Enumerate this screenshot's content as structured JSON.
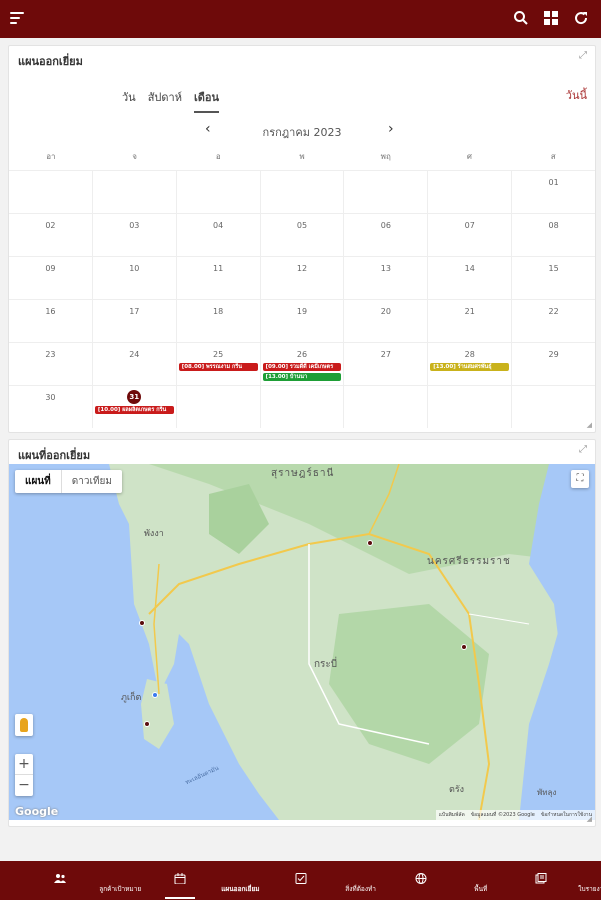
{
  "app": {
    "colors": {
      "primary": "#6e0a0a",
      "event_red": "#c91b1b",
      "event_green": "#1e9e36",
      "event_yellow": "#c9b21b"
    }
  },
  "calendar": {
    "title": "แผนออกเยี่ยม",
    "views": [
      "วัน",
      "สัปดาห์",
      "เดือน"
    ],
    "active_view": "เดือน",
    "today_label": "วันนี้",
    "month_label": "กรกฎาคม 2023",
    "weekdays": [
      "อา",
      "จ",
      "อ",
      "พ",
      "พฤ",
      "ศ",
      "ส"
    ],
    "weeks": [
      [
        "",
        "",
        "",
        "",
        "",
        "",
        "01"
      ],
      [
        "02",
        "03",
        "04",
        "05",
        "06",
        "07",
        "08"
      ],
      [
        "09",
        "10",
        "11",
        "12",
        "13",
        "14",
        "15"
      ],
      [
        "16",
        "17",
        "18",
        "19",
        "20",
        "21",
        "22"
      ],
      [
        "23",
        "24",
        "25",
        "26",
        "27",
        "28",
        "29"
      ],
      [
        "30",
        "31",
        "",
        "",
        "",
        "",
        ""
      ]
    ],
    "today_date": "31",
    "events": [
      {
        "text": "[08.00] พรรณงาม กรีน",
        "color": "red"
      },
      {
        "text": "[09.00] รวมดีดี เคมีเกษตร",
        "color": "red"
      },
      {
        "text": "[13.00] บ้านนา",
        "color": "green"
      },
      {
        "text": "[13.00] ร้านสมศรพันธุ์",
        "color": "yellow"
      },
      {
        "text": "[10.00] ผลผลิตเกษตร กรีน",
        "color": "red"
      }
    ]
  },
  "map_card": {
    "title": "แผนที่ออกเยี่ยม",
    "map_type_options": [
      "แผนที่",
      "ดาวเทียม"
    ],
    "selected_map_type": "แผนที่",
    "labels": {
      "surat": "สุราษฎร์ธานี",
      "nakhon": "นครศรีธรรมราช",
      "krabi": "กระบี่",
      "phangnga": "พังงา",
      "phuket": "ภูเก็ต",
      "trang": "ตรัง",
      "phatthalung": "พัทลุง",
      "andaman": "ทะเลอันดามัน"
    },
    "google": "Google",
    "attribution": [
      "แป้นพิมพ์ลัด",
      "ข้อมูลแผนที่ ©2023 Google",
      "ข้อกำหนดในการใช้งาน"
    ]
  },
  "bottom_nav": [
    {
      "label": "ลูกค้าเป้าหมาย",
      "icon": "customers-icon",
      "active": false
    },
    {
      "label": "แผนออกเยี่ยม",
      "icon": "calendar-icon",
      "active": true
    },
    {
      "label": "สิ่งที่ต้องทำ",
      "icon": "checklist-icon",
      "active": false
    },
    {
      "label": "พื้นที่",
      "icon": "globe-icon",
      "active": false
    },
    {
      "label": "ใบรายงานลูกค้า",
      "icon": "report-icon",
      "active": false
    }
  ]
}
